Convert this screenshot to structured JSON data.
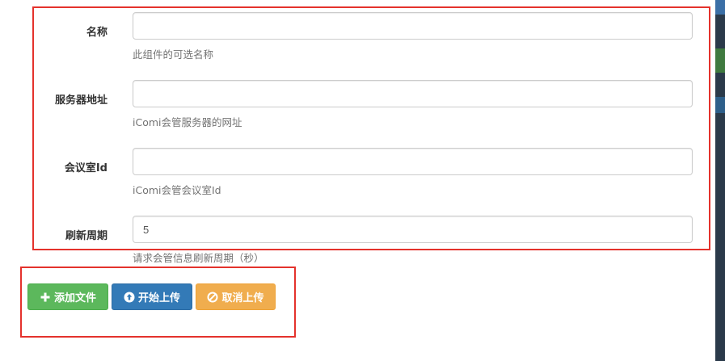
{
  "form": {
    "fields": [
      {
        "label": "名称",
        "value": "",
        "placeholder": "",
        "help": "此组件的可选名称"
      },
      {
        "label": "服务器地址",
        "value": "",
        "placeholder": "",
        "help": "iComi会管服务器的网址"
      },
      {
        "label": "会议室Id",
        "value": "",
        "placeholder": "",
        "help": "iComi会管会议室Id"
      },
      {
        "label": "刷新周期",
        "value": "5",
        "placeholder": "",
        "help": "请求会管信息刷新周期（秒）"
      }
    ]
  },
  "buttons": {
    "add_label": "添加文件",
    "start_label": "开始上传",
    "cancel_label": "取消上传"
  },
  "icons": {
    "add": "plus-icon",
    "start": "upload-circle-icon",
    "cancel": "ban-icon"
  },
  "colors": {
    "highlight_border": "#e4322c",
    "success": "#5cb85c",
    "primary": "#337ab7",
    "warning": "#f0ad4e"
  }
}
